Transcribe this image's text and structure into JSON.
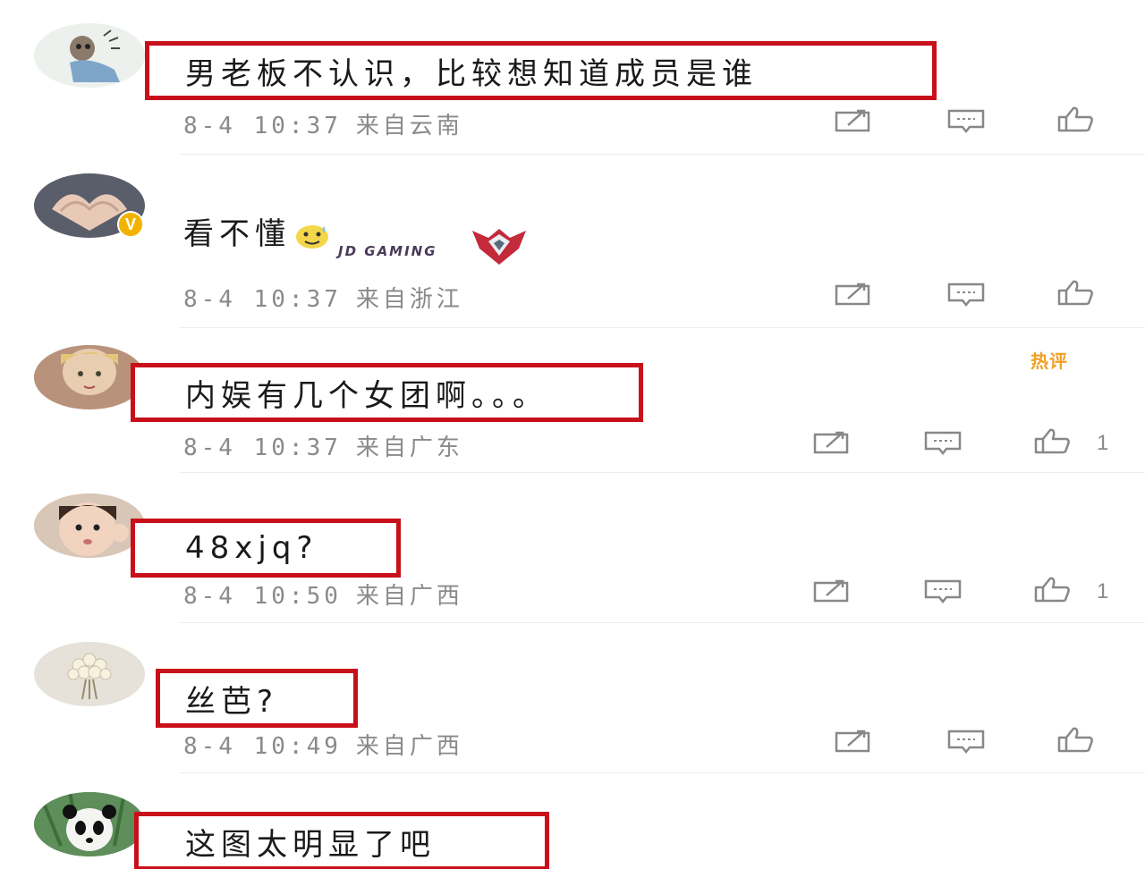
{
  "comments": [
    {
      "text": "男老板不认识，比较想知道成员是谁",
      "time": "8-4 10:37",
      "location": "来自云南",
      "like_count": "",
      "avatar": "monkey-sticker-avatar"
    },
    {
      "text": "看不懂",
      "time": "8-4 10:37",
      "location": "来自浙江",
      "like_count": "",
      "avatar": "heart-hands-avatar",
      "verified_badge": "V",
      "badge_text": "JD GAMING",
      "emoji": "sweat-smile-emoji"
    },
    {
      "text": "内娱有几个女团啊。。。",
      "time": "8-4 10:37",
      "location": "来自广东",
      "like_count": "1",
      "avatar": "doll-avatar",
      "hot_badge": "热评"
    },
    {
      "text": "48xjq?",
      "time": "8-4 10:50",
      "location": "来自广西",
      "like_count": "1",
      "avatar": "child-photo-avatar"
    },
    {
      "text": "丝芭?",
      "time": "8-4 10:49",
      "location": "来自广西",
      "like_count": "",
      "avatar": "flowers-avatar"
    },
    {
      "text": "这图太明显了吧",
      "avatar": "panda-avatar"
    }
  ],
  "colors": {
    "highlight_box": "#c8101a",
    "meta_text": "#8a8a8a",
    "verified": "#f2b300",
    "hot": "#f0a020"
  },
  "icons": {
    "share": "share-icon",
    "comment": "comment-icon",
    "like": "thumbs-up-icon"
  }
}
